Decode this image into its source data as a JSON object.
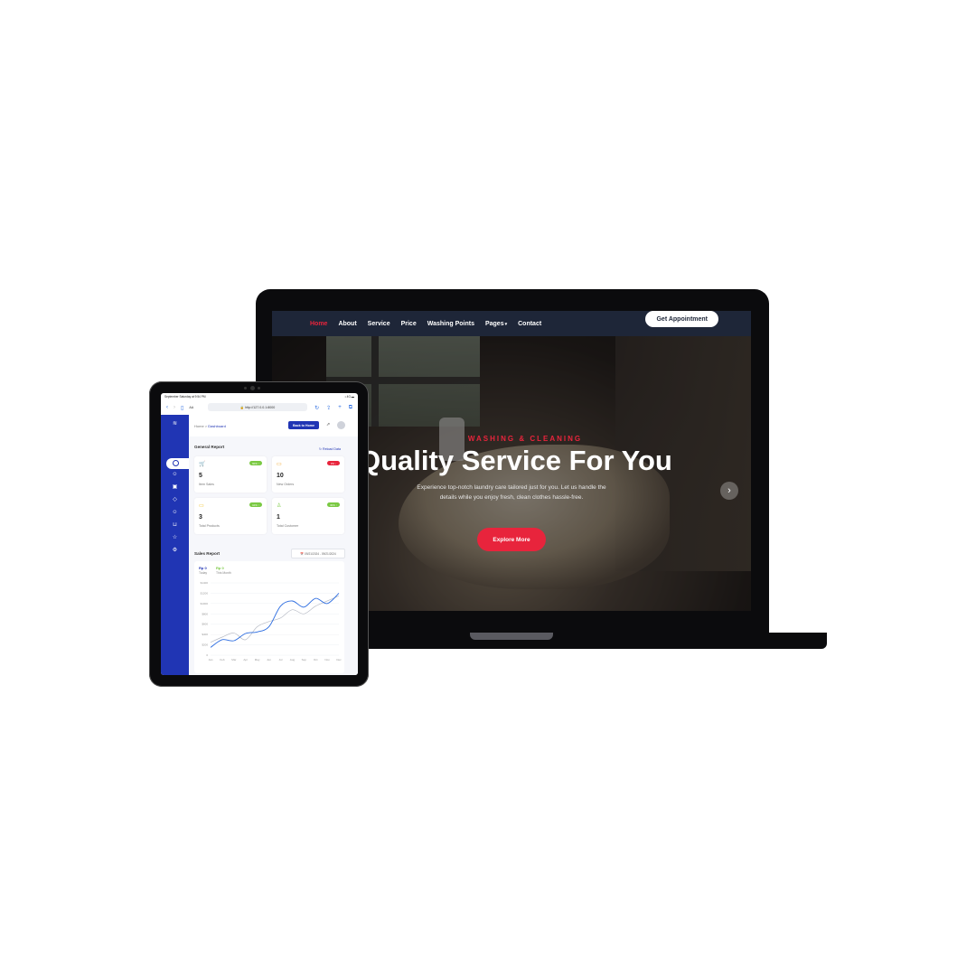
{
  "laptop": {
    "nav": {
      "items": [
        "Home",
        "About",
        "Service",
        "Price",
        "Washing Points",
        "Pages"
      ],
      "pages_caret": "▾",
      "cta": "Get Appointment",
      "active_color": "#e8243c"
    },
    "hero": {
      "kicker": "WASHING & CLEANING",
      "title": "Quality Service For You",
      "description": "Experience top-notch laundry care tailored just for you. Let us handle the details while you enjoy fresh, clean clothes hassle-free.",
      "button": "Explore More",
      "next_icon": "›"
    }
  },
  "tablet": {
    "status_bar": {
      "time": "September Saturday at 9:54 PM",
      "indicators": "▪ 4G ▬"
    },
    "browser": {
      "url": "🔒 http://127.0.0.1:8000",
      "aa": "AA"
    },
    "breadcrumb": {
      "home": "Home",
      "sep": ">",
      "current": "Dashboard"
    },
    "back_button": "Back to Home",
    "general_report": {
      "title": "General Report",
      "reload": "Reload Data",
      "cards": [
        {
          "icon": "cart-icon",
          "glyph": "🛒",
          "value": "5",
          "label": "Item Sales",
          "badge": "60% ↑",
          "badge_color": "#7ac943"
        },
        {
          "icon": "card-icon",
          "glyph": "▭",
          "value": "10",
          "label": "New Orders",
          "badge": "0% ↓",
          "badge_color": "#e8243c"
        },
        {
          "icon": "monitor-icon",
          "glyph": "▭",
          "value": "3",
          "label": "Total Products",
          "badge": "10% ↑",
          "badge_color": "#7ac943"
        },
        {
          "icon": "user-icon",
          "glyph": "♙",
          "value": "1",
          "label": "Total Customer",
          "badge": "30% ↑",
          "badge_color": "#7ac943"
        }
      ]
    },
    "sales_report": {
      "title": "Sales Report",
      "date_range": "📅 09/21/2024 - 09/21/2024",
      "today_value": "Rp 0",
      "today_label": "Today",
      "month_value": "Rp 0",
      "month_label": "This Month"
    }
  },
  "chart_data": {
    "type": "line",
    "categories": [
      "Jan",
      "Feb",
      "Mar",
      "Apr",
      "May",
      "Jun",
      "Jul",
      "Aug",
      "Sep",
      "Oct",
      "Nov",
      "Dec"
    ],
    "y_ticks": [
      "0",
      "$200",
      "$400",
      "$600",
      "$800",
      "$1000",
      "$1200",
      "$1400"
    ],
    "ylim": [
      0,
      1400
    ],
    "series": [
      {
        "values": [
          150,
          300,
          280,
          420,
          450,
          550,
          950,
          1050,
          930,
          1100,
          1000,
          1200
        ],
        "color": "#2a6be0"
      },
      {
        "values": [
          250,
          350,
          430,
          300,
          550,
          650,
          720,
          880,
          800,
          950,
          1050,
          1150
        ],
        "color": "#b8bcc6"
      }
    ]
  }
}
